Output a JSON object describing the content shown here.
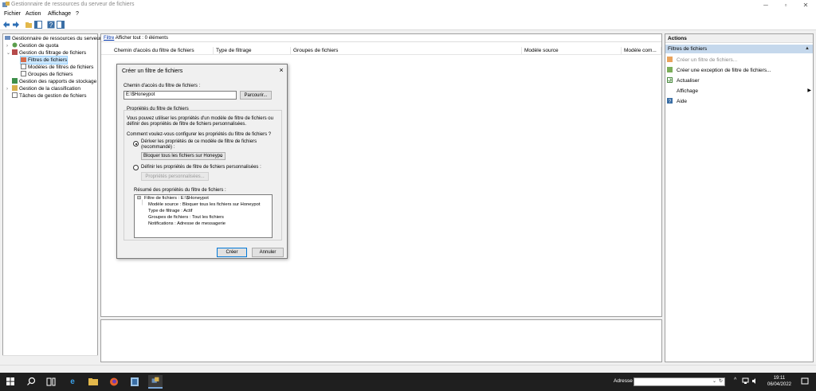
{
  "window": {
    "title": "Gestionnaire de ressources du serveur de fichiers",
    "minimize": "─",
    "maximize": "▫",
    "close": "✕"
  },
  "menu": [
    "Fichier",
    "Action",
    "Affichage",
    "?"
  ],
  "tree": {
    "items": [
      {
        "label": "Gestionnaire de ressources du serveur",
        "icon": "server-icon"
      },
      {
        "label": "Gestion de quota",
        "icon": "quota-icon"
      },
      {
        "label": "Gestion du filtrage de fichiers",
        "icon": "filter-icon"
      },
      {
        "label": "Filtres de fichiers",
        "icon": "folder-icon"
      },
      {
        "label": "Modèles de filtres de fichiers",
        "icon": "folder-icon"
      },
      {
        "label": "Groupes de fichiers",
        "icon": "folder-icon"
      },
      {
        "label": "Gestion des rapports de stockage",
        "icon": "report-icon"
      },
      {
        "label": "Gestion de la classification",
        "icon": "classification-icon"
      },
      {
        "label": "Tâches de gestion de fichiers",
        "icon": "tasks-icon"
      }
    ]
  },
  "center": {
    "filter_link": "Filtre",
    "filter_text": "Afficher tout : 0 éléments",
    "columns": [
      "Chemin d'accès du filtre de fichiers",
      "Type de filtrage",
      "Groupes de fichiers",
      "Modèle source",
      "Modèle com..."
    ]
  },
  "actions": {
    "header": "Actions",
    "section": "Filtres de fichiers",
    "items": [
      {
        "label": "Créer un filtre de fichiers...",
        "disabled": true
      },
      {
        "label": "Créer une exception de filtre de fichiers...",
        "disabled": false
      },
      {
        "label": "Actualiser",
        "disabled": false
      },
      {
        "label": "Affichage",
        "disabled": false
      },
      {
        "label": "Aide",
        "disabled": false
      }
    ]
  },
  "dialog": {
    "title": "Créer un filtre de fichiers",
    "path_label": "Chemin d'accès du filtre de fichiers :",
    "path_value": "E:\\$Honeypot",
    "browse_button": "Parcourir...",
    "props_group": "Propriétés du filtre de fichiers",
    "props_desc_1": "Vous pouvez utiliser les propriétés d'un modèle de filtre de fichiers ou",
    "props_desc_2": "définir des propriétés de filtre de fichiers personnalisées.",
    "question": "Comment voulez-vous configurer les propriétés du filtre de fichiers ?",
    "radio1_line1": "Dériver les propriétés de ce modèle de filtre de fichiers",
    "radio1_line2": "(recommandé) :",
    "template_value": "Bloquer tous les fichiers sur Honeypo",
    "radio2": "Définir les propriétés de filtre de fichiers personnalisées :",
    "custom_button": "Propriétés personnalisées...",
    "summary_label": "Résumé des propriétés du filtre de fichiers :",
    "summary": {
      "root": "Filtre de fichiers : E:\\$Honeypot",
      "rows": [
        "Modèle source : Bloquer tous les fichiers sur Honeypot",
        "Type de filtrage : Actif",
        "Groupes de fichiers : Tout les fichiers",
        "Notifications : Adresse de messagerie"
      ]
    },
    "create_button": "Créer",
    "cancel_button": "Annuler"
  },
  "taskbar": {
    "address_label": "Adresse",
    "time": "19:11",
    "date": "06/04/2022"
  }
}
